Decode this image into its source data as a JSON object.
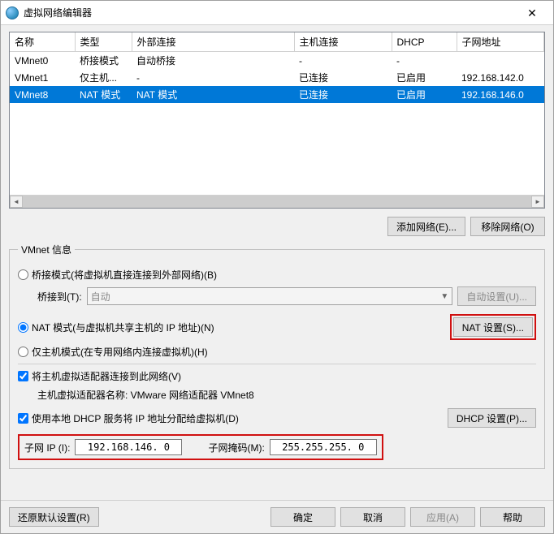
{
  "title": "虚拟网络编辑器",
  "table": {
    "headers": [
      "名称",
      "类型",
      "外部连接",
      "主机连接",
      "DHCP",
      "子网地址"
    ],
    "rows": [
      {
        "name": "VMnet0",
        "type": "桥接模式",
        "ext": "自动桥接",
        "host": "-",
        "dhcp": "-",
        "subnet": ""
      },
      {
        "name": "VMnet1",
        "type": "仅主机...",
        "ext": "-",
        "host": "已连接",
        "dhcp": "已启用",
        "subnet": "192.168.142.0"
      },
      {
        "name": "VMnet8",
        "type": "NAT 模式",
        "ext": "NAT 模式",
        "host": "已连接",
        "dhcp": "已启用",
        "subnet": "192.168.146.0",
        "selected": true
      }
    ]
  },
  "buttons": {
    "add_network": "添加网络(E)...",
    "remove_network": "移除网络(O)",
    "auto_config": "自动设置(U)...",
    "nat_settings": "NAT 设置(S)...",
    "dhcp_settings": "DHCP 设置(P)...",
    "restore_defaults": "还原默认设置(R)",
    "ok": "确定",
    "cancel": "取消",
    "apply": "应用(A)",
    "help": "帮助"
  },
  "group": {
    "legend": "VMnet 信息",
    "radio_bridge": "桥接模式(将虚拟机直接连接到外部网络)(B)",
    "bridge_to_label": "桥接到(T):",
    "bridge_to_value": "自动",
    "radio_nat": "NAT 模式(与虚拟机共享主机的 IP 地址)(N)",
    "radio_hostonly": "仅主机模式(在专用网络内连接虚拟机)(H)",
    "check_host_adapter": "将主机虚拟适配器连接到此网络(V)",
    "host_adapter_name": "主机虚拟适配器名称: VMware 网络适配器 VMnet8",
    "check_dhcp": "使用本地 DHCP 服务将 IP 地址分配给虚拟机(D)",
    "subnet_ip_label": "子网 IP (I):",
    "subnet_ip_value": "192.168.146. 0",
    "subnet_mask_label": "子网掩码(M):",
    "subnet_mask_value": "255.255.255. 0"
  }
}
